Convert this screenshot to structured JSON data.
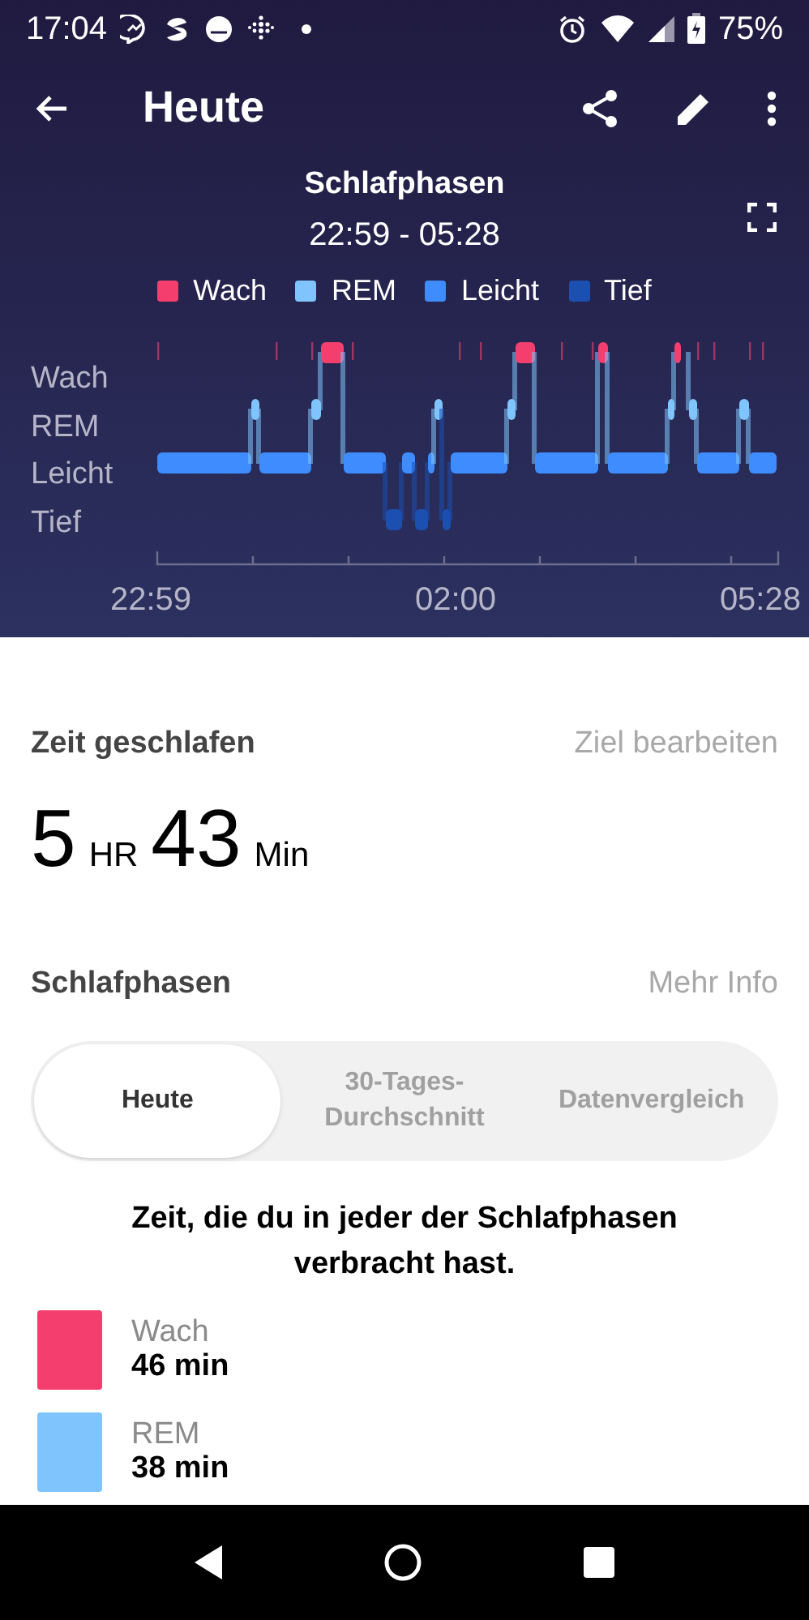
{
  "status_bar": {
    "time": "17:04",
    "battery": "75%"
  },
  "toolbar": {
    "title": "Heute"
  },
  "chart": {
    "title": "Schlafphasen",
    "range": "22:59 - 05:28",
    "legend": [
      {
        "label": "Wach",
        "color": "#f43f6e"
      },
      {
        "label": "REM",
        "color": "#7fc4fc"
      },
      {
        "label": "Leicht",
        "color": "#3f8cff"
      },
      {
        "label": "Tief",
        "color": "#1b4fb0"
      }
    ],
    "y_labels": [
      "Wach",
      "REM",
      "Leicht",
      "Tief"
    ],
    "x_labels": [
      "22:59",
      "02:00",
      "05:28"
    ]
  },
  "sleep_time": {
    "label": "Zeit geschlafen",
    "action": "Ziel bearbeiten",
    "hours": "5",
    "hours_unit": "HR",
    "minutes": "43",
    "minutes_unit": "Min"
  },
  "phases": {
    "label": "Schlafphasen",
    "action": "Mehr Info",
    "tabs": [
      {
        "label": "Heute",
        "selected": true
      },
      {
        "label": "30-Tages-\nDurchschnitt",
        "selected": false
      },
      {
        "label": "Datenvergleich",
        "selected": false
      }
    ],
    "description": "Zeit, die du in jeder der Schlafphasen verbracht hast.",
    "items": [
      {
        "label": "Wach",
        "value": "46 min",
        "color": "#f43f6e"
      },
      {
        "label": "REM",
        "value": "38 min",
        "color": "#7fc4fc"
      }
    ]
  }
}
